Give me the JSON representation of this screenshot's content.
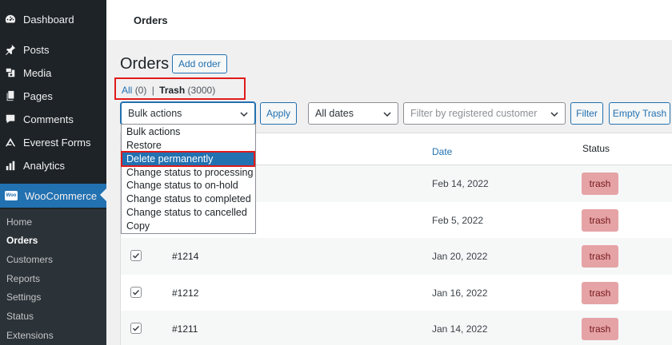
{
  "sidebar": {
    "items": [
      {
        "label": "Dashboard",
        "icon": "dashboard-icon"
      },
      {
        "label": "Posts",
        "icon": "pin-icon"
      },
      {
        "label": "Media",
        "icon": "media-icon"
      },
      {
        "label": "Pages",
        "icon": "pages-icon"
      },
      {
        "label": "Comments",
        "icon": "comments-icon"
      },
      {
        "label": "Everest Forms",
        "icon": "everest-forms-icon"
      },
      {
        "label": "Analytics",
        "icon": "analytics-icon"
      },
      {
        "label": "WooCommerce",
        "icon": "woocommerce-icon",
        "icon_text": "Woo"
      }
    ],
    "submenu": [
      "Home",
      "Orders",
      "Customers",
      "Reports",
      "Settings",
      "Status",
      "Extensions"
    ]
  },
  "header": {
    "title": "Orders"
  },
  "page": {
    "title": "Orders",
    "add_order_label": "Add order"
  },
  "views": {
    "all_label": "All",
    "all_count": "(0)",
    "separator": "|",
    "trash_label": "Trash",
    "trash_count": "(3000)"
  },
  "filters": {
    "bulk_actions": "Bulk actions",
    "apply_label": "Apply",
    "dates": "All dates",
    "customer_placeholder": "Filter by registered customer",
    "filter_label": "Filter",
    "empty_trash_label": "Empty Trash"
  },
  "bulk_menu": {
    "options": [
      "Bulk actions",
      "Restore",
      "Delete permanently",
      "Change status to processing",
      "Change status to on-hold",
      "Change status to completed",
      "Change status to cancelled",
      "Copy"
    ],
    "highlighted": "Delete permanently"
  },
  "table": {
    "columns": {
      "date": "Date",
      "status": "Status"
    },
    "rows": [
      {
        "order": "",
        "date": "Feb 14, 2022",
        "status": "trash",
        "checked": false
      },
      {
        "order": "",
        "date": "Feb 5, 2022",
        "status": "trash",
        "checked": false
      },
      {
        "order": "#1214",
        "date": "Jan 20, 2022",
        "status": "trash",
        "checked": true
      },
      {
        "order": "#1212",
        "date": "Jan 16, 2022",
        "status": "trash",
        "checked": true
      },
      {
        "order": "#1211",
        "date": "Jan 14, 2022",
        "status": "trash",
        "checked": true
      }
    ]
  },
  "colors": {
    "accent": "#2271b1",
    "sidebar_bg": "#1d2327",
    "highlight_box": "#e01b1b",
    "trash_badge_bg": "#e5a3a6",
    "trash_badge_text": "#761919"
  }
}
